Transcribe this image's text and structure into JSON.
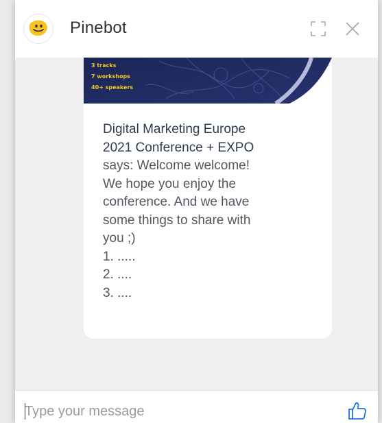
{
  "header": {
    "title": "Pinebot",
    "avatar_icon": "smiley-bot-icon",
    "expand_icon": "expand-icon",
    "close_icon": "close-icon"
  },
  "banner": {
    "stats": [
      "3 tracks",
      "7 workshops",
      "40+ speakers"
    ]
  },
  "message": {
    "sender_lines": [
      "Digital Marketing Europe",
      "2021 Conference + EXPO"
    ],
    "body_lines": [
      "says: Welcome welcome!",
      "We hope you enjoy the",
      "conference. And we have",
      "some things to share with",
      "you ;)",
      "1. .....",
      "2. ....",
      "3. ...."
    ]
  },
  "composer": {
    "placeholder": "Type your message",
    "value": "",
    "like_icon": "thumbs-up-icon"
  },
  "colors": {
    "accent_blue": "#1e73e8",
    "bot_yellow": "#f7c325",
    "banner_navy": "#1f2a5c",
    "banner_text_yellow": "#f3c623",
    "chat_background": "#efefef"
  }
}
